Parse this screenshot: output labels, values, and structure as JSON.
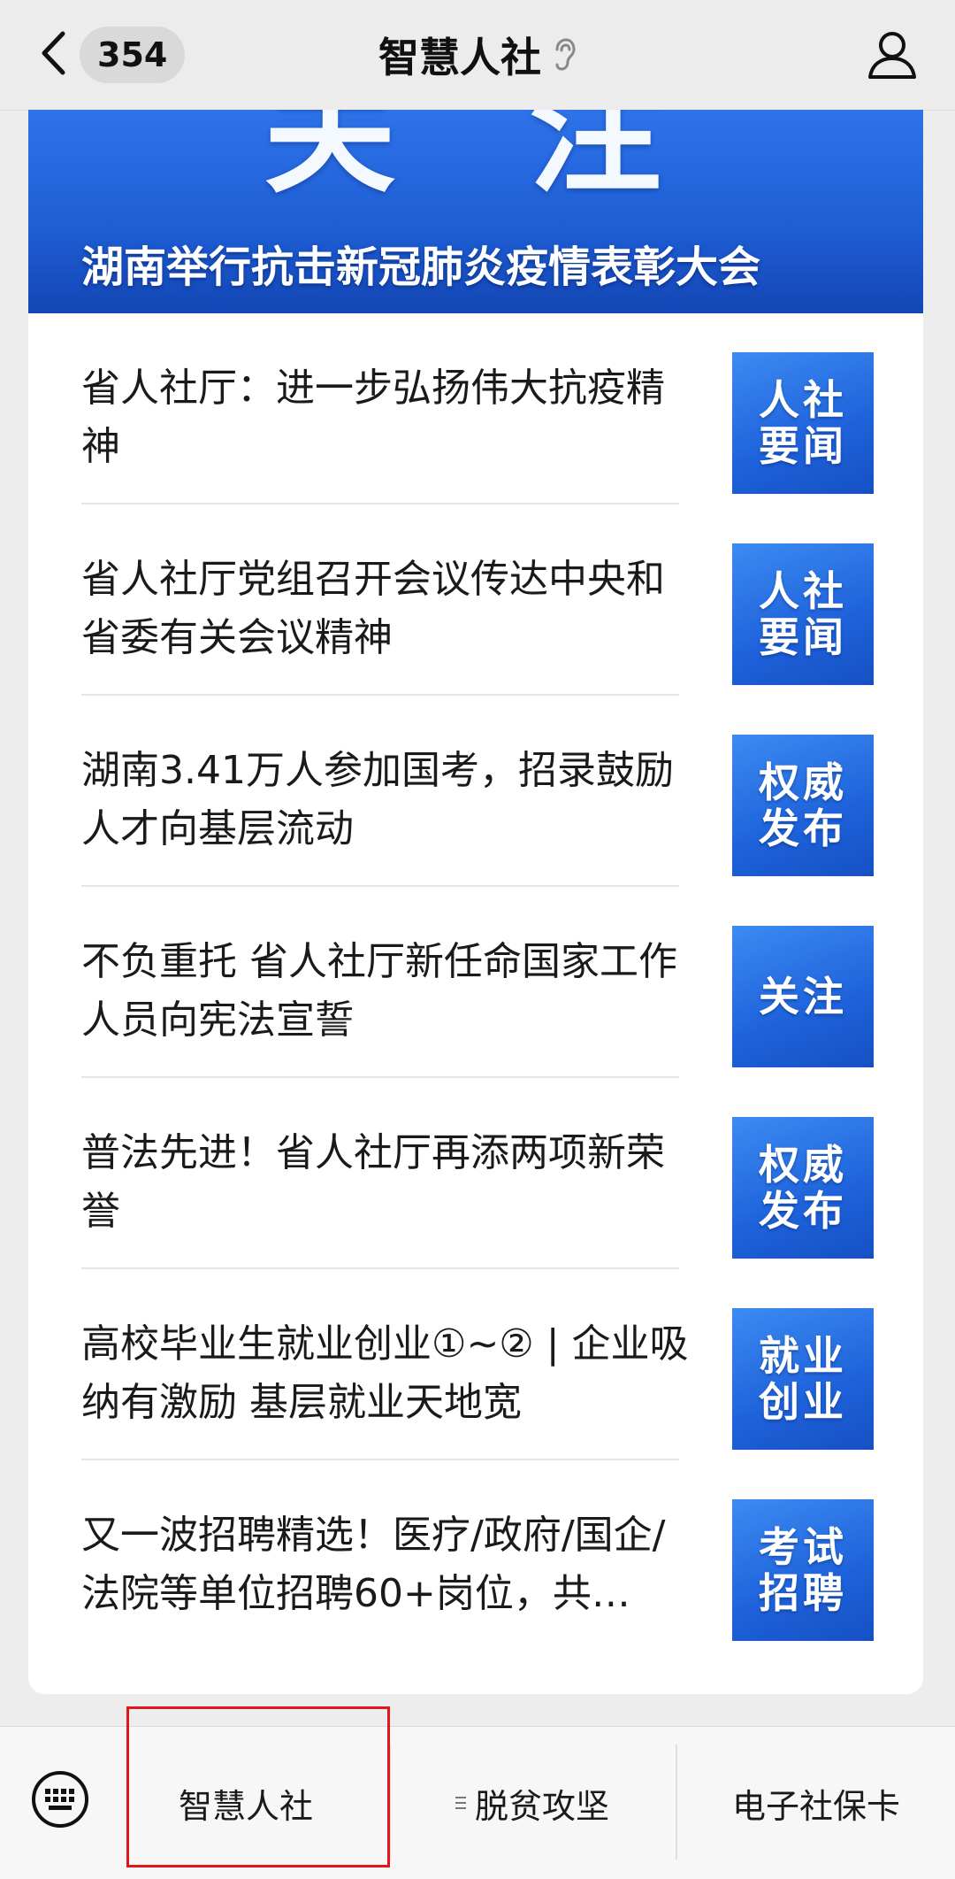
{
  "nav": {
    "unread_count": "354",
    "title": "智慧人社"
  },
  "banner": {
    "big_text": "关注",
    "caption": "湖南举行抗击新冠肺炎疫情表彰大会"
  },
  "news": [
    {
      "title": "省人社厅：进一步弘扬伟大抗疫精神",
      "tag": "人社要闻"
    },
    {
      "title": "省人社厅党组召开会议传达中央和省委有关会议精神",
      "tag": "人社要闻"
    },
    {
      "title": "湖南3.41万人参加国考，招录鼓励人才向基层流动",
      "tag": "权威发布"
    },
    {
      "title": "不负重托 省人社厅新任命国家工作人员向宪法宣誓",
      "tag": "关注"
    },
    {
      "title": "普法先进！省人社厅再添两项新荣誉",
      "tag": "权威发布"
    },
    {
      "title": "高校毕业生就业创业①~② | 企业吸纳有激励 基层就业天地宽",
      "tag": "就业创业"
    },
    {
      "title": "又一波招聘精选！医疗/政府/国企/法院等单位招聘60+岗位，共…",
      "tag": "考试招聘"
    }
  ],
  "bottom_menu": {
    "item1": "智慧人社",
    "item2": "脱贫攻坚",
    "item3": "电子社保卡"
  },
  "colors": {
    "accent_blue": "#1f5fd6",
    "highlight_red": "#e0171b"
  }
}
